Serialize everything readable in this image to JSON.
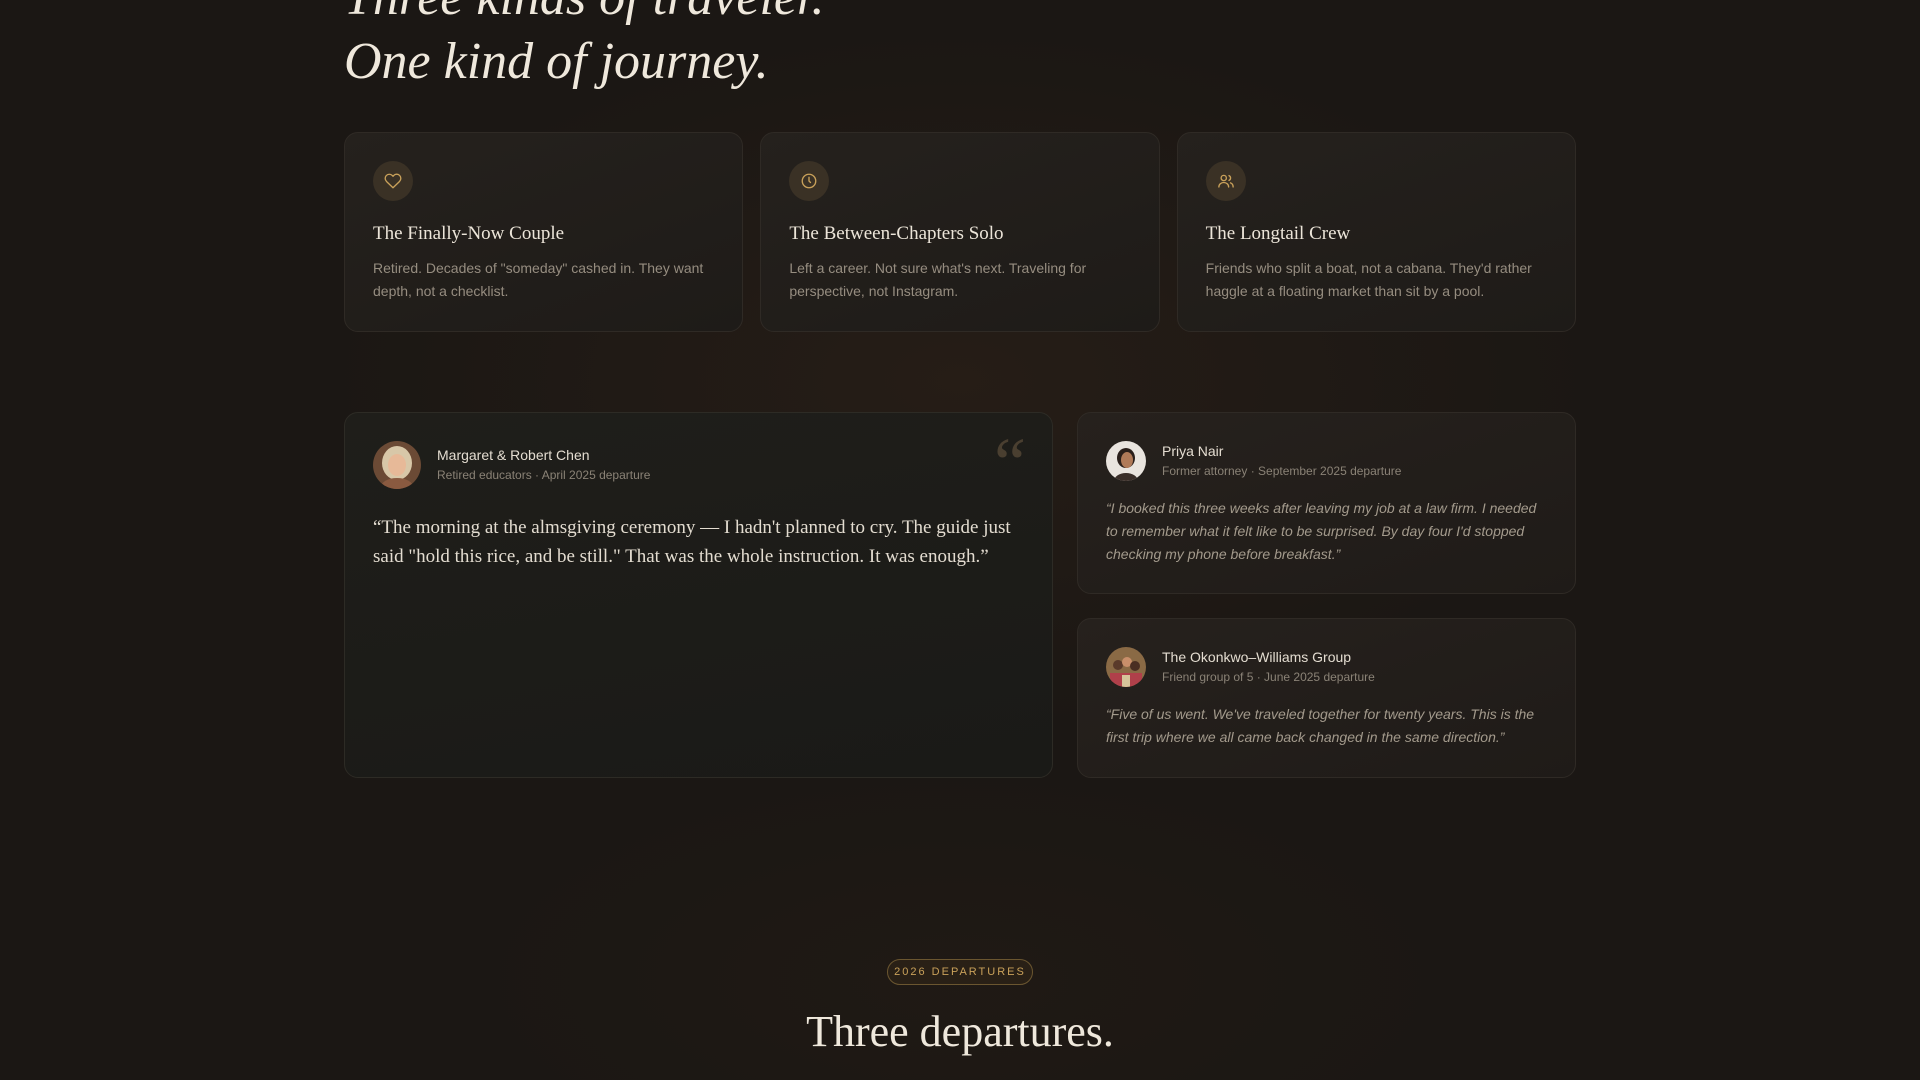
{
  "hero": {
    "line1": "Three kinds of traveler.",
    "line2": "One kind of journey."
  },
  "traveler_types": [
    {
      "icon": "heart-icon",
      "title": "The Finally-Now Couple",
      "description": "Retired. Decades of \"someday\" cashed in. They want depth, not a checklist."
    },
    {
      "icon": "clock-icon",
      "title": "The Between-Chapters Solo",
      "description": "Left a career. Not sure what's next. Traveling for perspective, not Instagram."
    },
    {
      "icon": "users-icon",
      "title": "The Longtail Crew",
      "description": "Friends who split a boat, not a cabana. They'd rather haggle at a floating market than sit by a pool."
    }
  ],
  "testimonials": {
    "featured": {
      "name": "Margaret & Robert Chen",
      "meta": "Retired educators · April 2025 departure",
      "quote_mark": "“",
      "quote": "“The morning at the almsgiving ceremony — I hadn't planned to cry. The guide just said \"hold this rice, and be still.\" That was the whole instruction. It was enough.”"
    },
    "others": [
      {
        "name": "Priya Nair",
        "meta": "Former attorney · September 2025 departure",
        "quote": "“I booked this three weeks after leaving my job at a law firm. I needed to remember what it felt like to be surprised. By day four I'd stopped checking my phone before breakfast.”"
      },
      {
        "name": "The Okonkwo–Williams Group",
        "meta": "Friend group of 5 · June 2025 departure",
        "quote": "“Five of us went. We've traveled together for twenty years. This is the first trip where we all came back changed in the same direction.”"
      }
    ]
  },
  "departures": {
    "badge": "2026 DEPARTURES",
    "title": "Three departures."
  },
  "colors": {
    "background": "#1b1714",
    "accent": "#c9a15a",
    "card_border": "#2f2a25"
  }
}
